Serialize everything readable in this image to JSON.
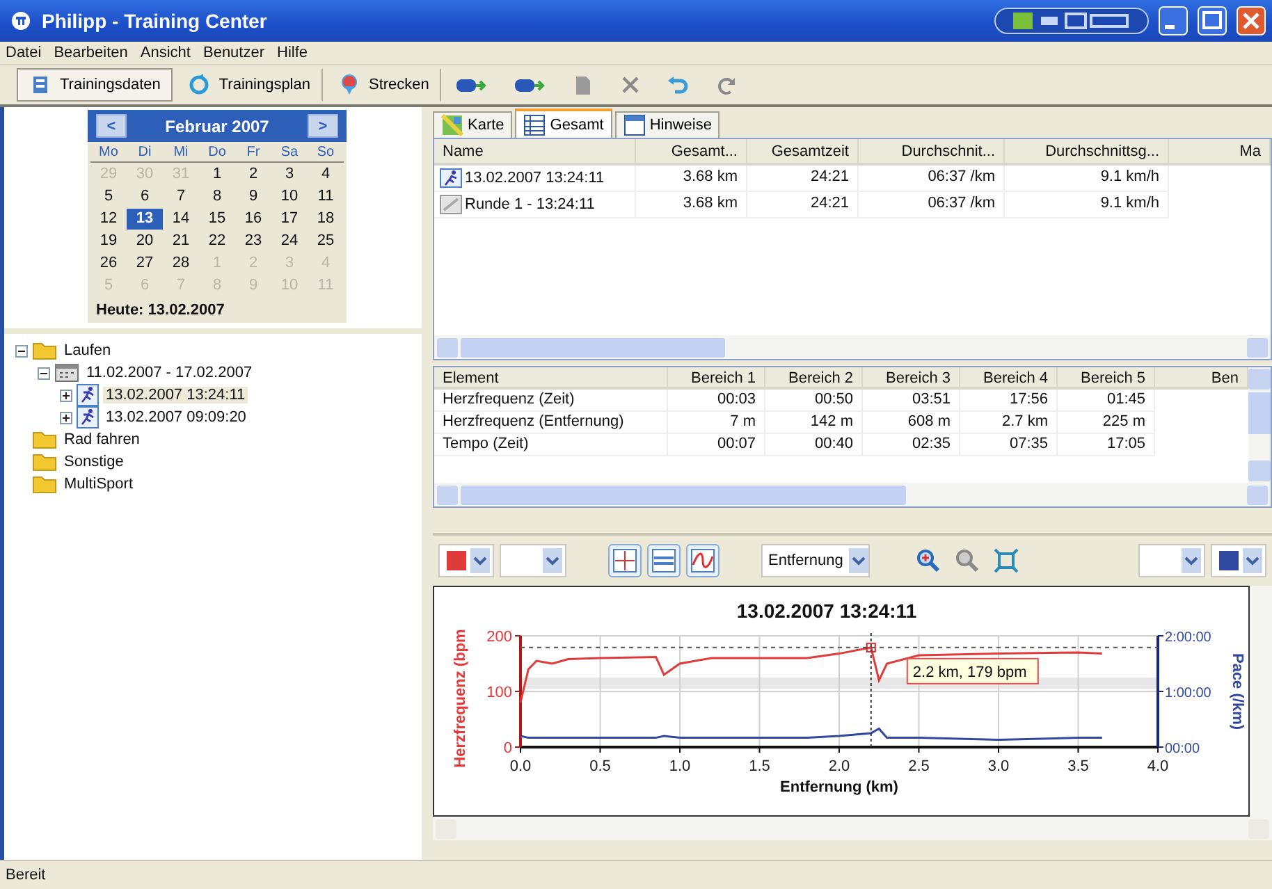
{
  "window": {
    "title": "Philipp - Training Center"
  },
  "menu": [
    "Datei",
    "Bearbeiten",
    "Ansicht",
    "Benutzer",
    "Hilfe"
  ],
  "toolbar": [
    {
      "label": "Trainingsdaten",
      "selected": true
    },
    {
      "label": "Trainingsplan",
      "selected": false
    },
    {
      "label": "Strecken",
      "selected": false
    }
  ],
  "calendar": {
    "month": "Februar 2007",
    "prev": "<",
    "next": ">",
    "weekdays": [
      "Mo",
      "Di",
      "Mi",
      "Do",
      "Fr",
      "Sa",
      "So"
    ],
    "weeks": [
      [
        {
          "day": "29",
          "other": true,
          "selected": false
        },
        {
          "day": "30",
          "other": true,
          "selected": false
        },
        {
          "day": "31",
          "other": true,
          "selected": false
        },
        {
          "day": "1",
          "other": false,
          "selected": false
        },
        {
          "day": "2",
          "other": false,
          "selected": false
        },
        {
          "day": "3",
          "other": false,
          "selected": false
        },
        {
          "day": "4",
          "other": false,
          "selected": false
        }
      ],
      [
        {
          "day": "5",
          "other": false,
          "selected": false
        },
        {
          "day": "6",
          "other": false,
          "selected": false
        },
        {
          "day": "7",
          "other": false,
          "selected": false
        },
        {
          "day": "8",
          "other": false,
          "selected": false
        },
        {
          "day": "9",
          "other": false,
          "selected": false
        },
        {
          "day": "10",
          "other": false,
          "selected": false
        },
        {
          "day": "11",
          "other": false,
          "selected": false
        }
      ],
      [
        {
          "day": "12",
          "other": false,
          "selected": false
        },
        {
          "day": "13",
          "other": false,
          "selected": true
        },
        {
          "day": "14",
          "other": false,
          "selected": false
        },
        {
          "day": "15",
          "other": false,
          "selected": false
        },
        {
          "day": "16",
          "other": false,
          "selected": false
        },
        {
          "day": "17",
          "other": false,
          "selected": false
        },
        {
          "day": "18",
          "other": false,
          "selected": false
        }
      ],
      [
        {
          "day": "19",
          "other": false,
          "selected": false
        },
        {
          "day": "20",
          "other": false,
          "selected": false
        },
        {
          "day": "21",
          "other": false,
          "selected": false
        },
        {
          "day": "22",
          "other": false,
          "selected": false
        },
        {
          "day": "23",
          "other": false,
          "selected": false
        },
        {
          "day": "24",
          "other": false,
          "selected": false
        },
        {
          "day": "25",
          "other": false,
          "selected": false
        }
      ],
      [
        {
          "day": "26",
          "other": false,
          "selected": false
        },
        {
          "day": "27",
          "other": false,
          "selected": false
        },
        {
          "day": "28",
          "other": false,
          "selected": false
        },
        {
          "day": "1",
          "other": true,
          "selected": false
        },
        {
          "day": "2",
          "other": true,
          "selected": false
        },
        {
          "day": "3",
          "other": true,
          "selected": false
        },
        {
          "day": "4",
          "other": true,
          "selected": false
        }
      ],
      [
        {
          "day": "5",
          "other": true,
          "selected": false
        },
        {
          "day": "6",
          "other": true,
          "selected": false
        },
        {
          "day": "7",
          "other": true,
          "selected": false
        },
        {
          "day": "8",
          "other": true,
          "selected": false
        },
        {
          "day": "9",
          "other": true,
          "selected": false
        },
        {
          "day": "10",
          "other": true,
          "selected": false
        },
        {
          "day": "11",
          "other": true,
          "selected": false
        }
      ]
    ],
    "today": "Heute: 13.02.2007"
  },
  "tree": [
    {
      "label": "Laufen",
      "kind": "folder",
      "expanded": true,
      "selected": false,
      "children": [
        {
          "label": "11.02.2007 - 17.02.2007",
          "kind": "week",
          "expanded": true,
          "selected": false,
          "children": [
            {
              "label": "13.02.2007 13:24:11",
              "kind": "run",
              "expanded": false,
              "selected": true
            },
            {
              "label": "13.02.2007 09:09:20",
              "kind": "run",
              "expanded": false,
              "selected": false
            }
          ]
        }
      ]
    },
    {
      "label": "Rad fahren",
      "kind": "folder",
      "selected": false
    },
    {
      "label": "Sonstige",
      "kind": "folder",
      "selected": false
    },
    {
      "label": "MultiSport",
      "kind": "folder",
      "selected": false
    }
  ],
  "tabs": [
    {
      "label": "Karte",
      "selected": false
    },
    {
      "label": "Gesamt",
      "selected": true
    },
    {
      "label": "Hinweise",
      "selected": false
    }
  ],
  "summary_table": {
    "columns": [
      "Name",
      "Gesamt...",
      "Gesamtzeit",
      "Durchschnit...",
      "Durchschnittsg...",
      "Ma"
    ],
    "rows": [
      {
        "kind": "run",
        "cells": [
          "13.02.2007 13:24:11",
          "3.68 km",
          "24:21",
          "06:37 /km",
          "9.1 km/h"
        ]
      },
      {
        "kind": "lap",
        "cells": [
          "Runde 1 - 13:24:11",
          "3.68 km",
          "24:21",
          "06:37 /km",
          "9.1 km/h"
        ]
      }
    ]
  },
  "zones_table": {
    "columns": [
      "Element",
      "Bereich 1",
      "Bereich 2",
      "Bereich 3",
      "Bereich 4",
      "Bereich 5",
      "Ben"
    ],
    "rows": [
      [
        "Herzfrequenz (Zeit)",
        "00:03",
        "00:50",
        "03:51",
        "17:56",
        "01:45"
      ],
      [
        "Herzfrequenz (Entfernung)",
        "7 m",
        "142 m",
        "608 m",
        "2.7 km",
        "225 m"
      ],
      [
        "Tempo (Zeit)",
        "00:07",
        "00:40",
        "02:35",
        "07:35",
        "17:05"
      ]
    ]
  },
  "chart_toolbar": {
    "axis_select": "Entfernung"
  },
  "chart_data": {
    "type": "line",
    "title": "13.02.2007 13:24:11",
    "xlabel": "Entfernung (km)",
    "ylabel": "Herzfrequenz (bpm",
    "y2label": "Pace (/km)",
    "x": [
      0,
      0.05,
      0.1,
      0.2,
      0.3,
      0.5,
      0.85,
      0.9,
      1.0,
      1.2,
      1.5,
      1.8,
      2.0,
      2.2,
      2.25,
      2.3,
      2.5,
      3.0,
      3.5,
      3.65
    ],
    "series": [
      {
        "color": "#e03a3a",
        "values": [
          80,
          140,
          155,
          150,
          158,
          160,
          162,
          130,
          150,
          160,
          160,
          160,
          168,
          179,
          120,
          150,
          165,
          168,
          170,
          168
        ]
      },
      {
        "color": "#3048a0",
        "axis": "y2",
        "values": [
          12,
          10,
          10,
          10,
          10,
          10,
          10,
          12,
          10,
          10,
          10,
          10,
          12,
          15,
          20,
          10,
          10,
          8,
          10,
          10
        ]
      }
    ],
    "xlim": [
      0,
      4
    ],
    "ylim": [
      0,
      200
    ],
    "xticks": [
      {
        "value": 0,
        "label": "0.0"
      },
      {
        "value": 0.5,
        "label": "0.5"
      },
      {
        "value": 1,
        "label": "1.0"
      },
      {
        "value": 1.5,
        "label": "1.5"
      },
      {
        "value": 2,
        "label": "2.0"
      },
      {
        "value": 2.5,
        "label": "2.5"
      },
      {
        "value": 3,
        "label": "3.0"
      },
      {
        "value": 3.5,
        "label": "3.5"
      },
      {
        "value": 4,
        "label": "4.0"
      }
    ],
    "yticks": [
      0,
      100,
      200
    ],
    "grid": true,
    "y2lim": [
      0,
      120
    ],
    "bands": [
      {
        "axis": "y",
        "from": 105,
        "to": 125
      }
    ],
    "ref_lines": [
      {
        "axis": "y",
        "value": 179
      },
      {
        "axis": "x",
        "value": 2.2
      }
    ],
    "y2ticks": [
      {
        "value": 0,
        "label": "00:00"
      },
      {
        "value": 60,
        "label": "1:00:00"
      },
      {
        "value": 120,
        "label": "2:00:00"
      }
    ],
    "annotations": [
      {
        "x": 2.2,
        "y": 179,
        "text": "2.2 km, 179 bpm"
      }
    ]
  },
  "status_bar": "Bereit"
}
